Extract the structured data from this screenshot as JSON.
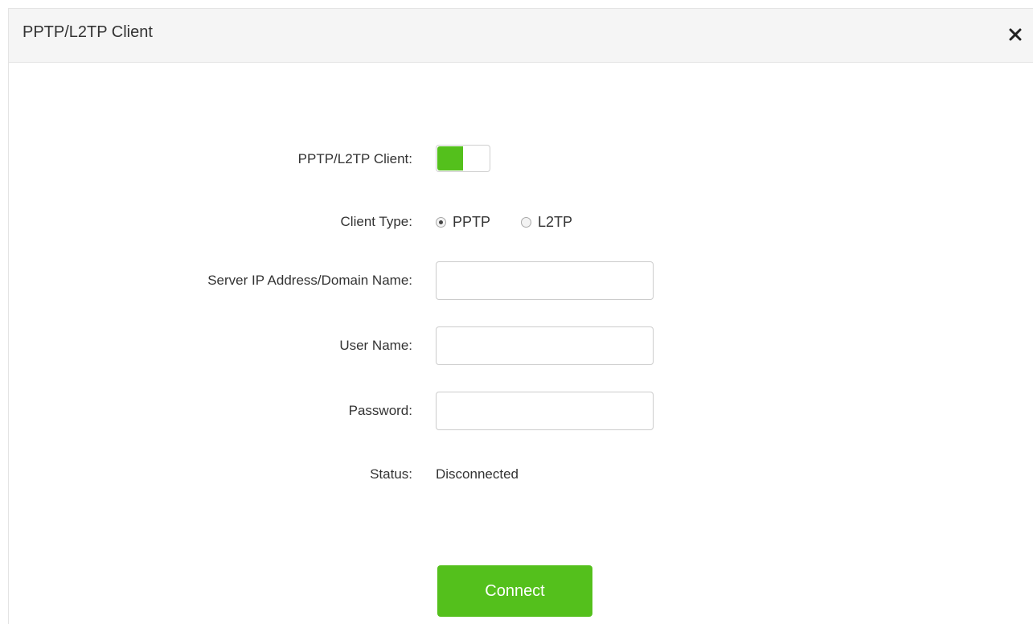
{
  "dialog": {
    "title": "PPTP/L2TP Client",
    "close_icon": "close-icon"
  },
  "form": {
    "client_toggle": {
      "label": "PPTP/L2TP Client:",
      "enabled": true
    },
    "client_type": {
      "label": "Client Type:",
      "options": [
        "PPTP",
        "L2TP"
      ],
      "selected": "PPTP"
    },
    "server": {
      "label": "Server IP Address/Domain Name:",
      "value": ""
    },
    "username": {
      "label": "User Name:",
      "value": ""
    },
    "password": {
      "label": "Password:",
      "value": ""
    },
    "status": {
      "label": "Status:",
      "value": "Disconnected"
    }
  },
  "actions": {
    "connect_label": "Connect"
  },
  "colors": {
    "accent": "#54c01c",
    "header_bg": "#f5f5f5",
    "text": "#333333"
  }
}
